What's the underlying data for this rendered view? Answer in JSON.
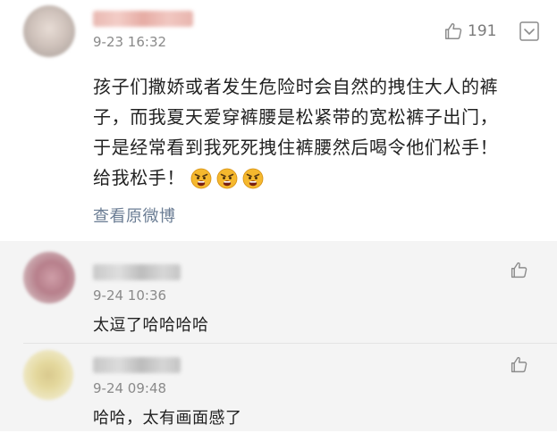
{
  "main_comment": {
    "timestamp": "9-23 16:32",
    "like_count": "191",
    "text_lines": [
      "孩子们撒娇或者发生危险时会自然的拽住大人的裤",
      "子，而我夏天爱穿裤腰是松紧带的宽松裤子出门，",
      "于是经常看到我死死拽住裤腰然后喝令他们松手！",
      "给我松手！"
    ],
    "emojis": [
      "angry-face-icon",
      "angry-face-icon",
      "angry-face-icon"
    ],
    "view_original_label": "查看原微博"
  },
  "replies": [
    {
      "timestamp": "9-24 10:36",
      "text": "太逗了哈哈哈哈"
    },
    {
      "timestamp": "9-24 09:48",
      "text": "哈哈，太有画面感了"
    }
  ],
  "colors": {
    "link": "#6b7d94",
    "reply_bg": "#f4f4f4",
    "icon_gray": "#8c8c8c"
  }
}
